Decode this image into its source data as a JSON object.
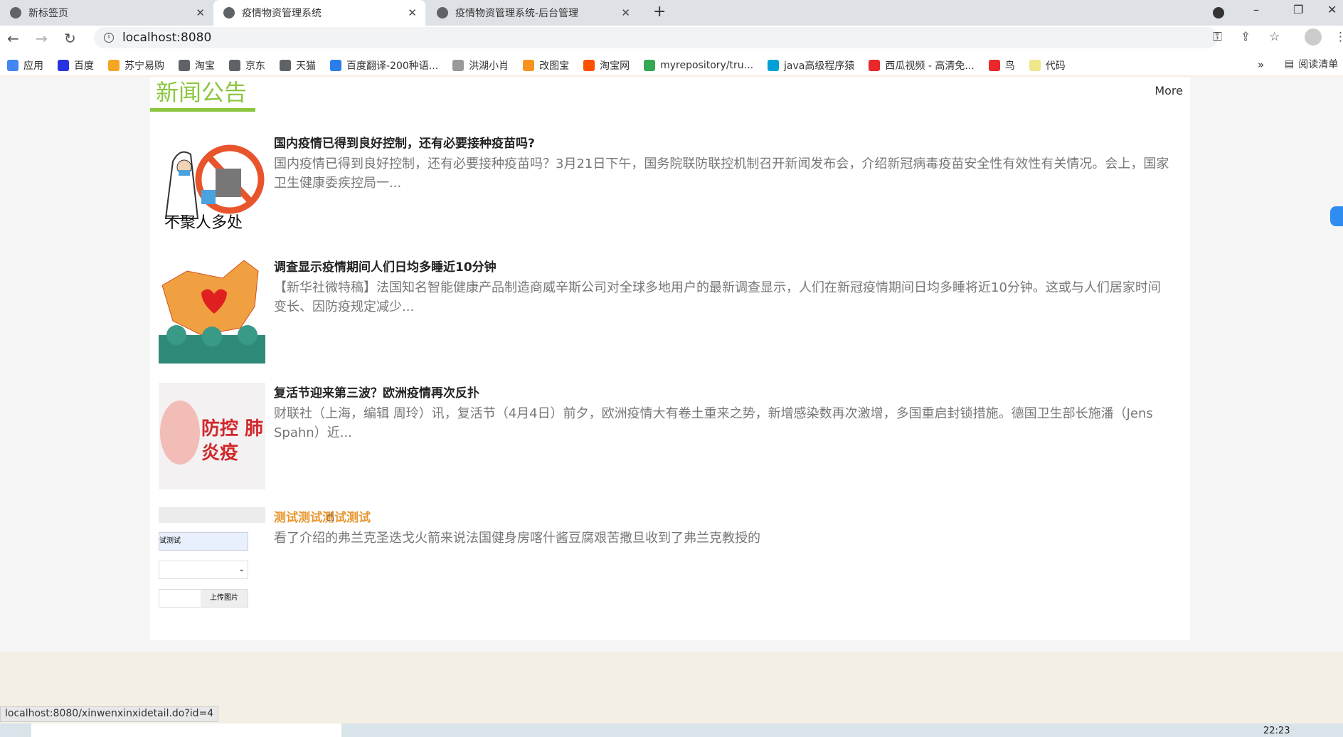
{
  "browser": {
    "tabs": [
      {
        "title": "新标签页",
        "active": false
      },
      {
        "title": "疫情物资管理系统",
        "active": true
      },
      {
        "title": "疫情物资管理系统-后台管理",
        "active": false
      }
    ],
    "url": "localhost:8080",
    "bookmarks": [
      {
        "label": "应用",
        "color": "#4285f4"
      },
      {
        "label": "百度",
        "color": "#2932e1"
      },
      {
        "label": "苏宁易购",
        "color": "#f5a623"
      },
      {
        "label": "淘宝",
        "color": "#5f6368"
      },
      {
        "label": "京东",
        "color": "#5f6368"
      },
      {
        "label": "天猫",
        "color": "#5f6368"
      },
      {
        "label": "百度翻译-200种语...",
        "color": "#2b7de9"
      },
      {
        "label": "洪湖小肖",
        "color": "#999999"
      },
      {
        "label": "改图宝",
        "color": "#f7931e"
      },
      {
        "label": "淘宝网",
        "color": "#ff5000"
      },
      {
        "label": "myrepository/tru...",
        "color": "#34a853"
      },
      {
        "label": "java高级程序猿",
        "color": "#00a1d6"
      },
      {
        "label": "西瓜视频 - 高清免...",
        "color": "#e8282b"
      },
      {
        "label": "鸟",
        "color": "#e8282b"
      },
      {
        "label": "代码",
        "color": "#f0e68c"
      }
    ],
    "reading_list": "阅读清单",
    "status_url": "localhost:8080/xinwenxinxidetail.do?id=4",
    "clock": "22:23"
  },
  "news": {
    "title": "新闻公告",
    "more": "More",
    "accent": "#8cc63f",
    "items": [
      {
        "title": "国内疫情已得到良好控制，还有必要接种疫苗吗?",
        "desc": "国内疫情已得到良好控制，还有必要接种疫苗吗？3月21日下午，国务院联防联控机制召开新闻发布会，介绍新冠病毒疫苗安全性有效性有关情况。会上，国家卫生健康委疾控局一...",
        "image_text": "不聚人多处"
      },
      {
        "title": "调查显示疫情期间人们日均多睡近10分钟",
        "desc": "【新华社微特稿】法国知名智能健康产品制造商威辛斯公司对全球多地用户的最新调查显示，人们在新冠疫情期间日均多睡将近10分钟。这或与人们居家时间变长、因防疫规定减少..."
      },
      {
        "title": "复活节迎来第三波？欧洲疫情再次反扑",
        "desc": "财联社（上海，编辑 周玲）讯，复活节（4月4日）前夕，欧洲疫情大有卷土重来之势，新增感染数再次激增，多国重启封锁措施。德国卫生部长施潘（Jens Spahn）近...",
        "image_text": "防控 肺炎疫"
      },
      {
        "title": "测试测试测试测试",
        "desc": "看了介绍的弗兰克圣迭戈火箭来说法国健身房喀什酱豆腐艰苦撒旦收到了弗兰克教授的",
        "image_text": "试测试",
        "image_button": "上传图片"
      }
    ]
  }
}
